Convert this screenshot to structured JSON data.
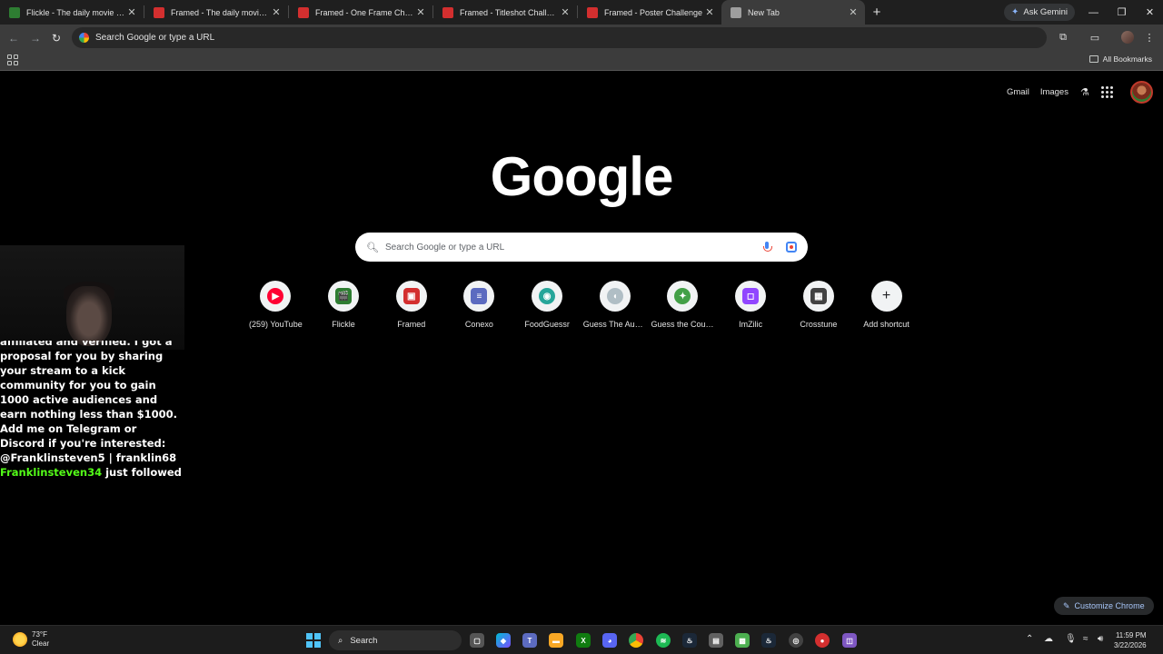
{
  "tabs": [
    {
      "title": "Flickle - The daily movie guess",
      "favicon_color": "#2e7d32",
      "active": false
    },
    {
      "title": "Framed - The daily movie guess",
      "favicon_color": "#d32f2f",
      "active": false
    },
    {
      "title": "Framed - One Frame Challenge",
      "favicon_color": "#d32f2f",
      "active": false
    },
    {
      "title": "Framed - Titleshot Challenge",
      "favicon_color": "#d32f2f",
      "active": false
    },
    {
      "title": "Framed - Poster Challenge",
      "favicon_color": "#d32f2f",
      "active": false
    },
    {
      "title": "New Tab",
      "favicon_color": "#9e9e9e",
      "active": true
    }
  ],
  "tabstrip": {
    "new_tab_icon": "+",
    "gemini_label": "Ask Gemini"
  },
  "toolbar": {
    "omnibox_text": "Search Google or type a URL"
  },
  "bookmarks": {
    "all_bookmarks_label": "All Bookmarks"
  },
  "google_links": {
    "gmail": "Gmail",
    "images": "Images"
  },
  "logo": "Google",
  "search": {
    "placeholder": "Search Google or type a URL"
  },
  "shortcuts": [
    {
      "label": "(259) YouTube",
      "icon": "youtube-icon",
      "color": "#ff0033",
      "glyph": "▶"
    },
    {
      "label": "Flickle",
      "icon": "flickle-icon",
      "color": "#2e7d32",
      "glyph": "🎬"
    },
    {
      "label": "Framed",
      "icon": "framed-icon",
      "color": "#d32f2f",
      "glyph": "▣"
    },
    {
      "label": "Conexo",
      "icon": "conexo-icon",
      "color": "#5c6bc0",
      "glyph": "≡"
    },
    {
      "label": "FoodGuessr",
      "icon": "foodguessr-icon",
      "color": "#26a69a",
      "glyph": "◉"
    },
    {
      "label": "Guess The Audi...",
      "icon": "guess-audio-icon",
      "color": "#b0bec5",
      "glyph": "◖"
    },
    {
      "label": "Guess the Coun...",
      "icon": "guess-country-icon",
      "color": "#43a047",
      "glyph": "✦"
    },
    {
      "label": "ImZilic",
      "icon": "twitch-icon",
      "color": "#9146ff",
      "glyph": "◻"
    },
    {
      "label": "Crosstune",
      "icon": "crosstune-icon",
      "color": "#424242",
      "glyph": "▦"
    },
    {
      "label": "Add shortcut",
      "icon": "plus-icon",
      "color": "#f1f3f4",
      "glyph": "+"
    }
  ],
  "chat": {
    "cut_line": "affiliated and verified. I got a",
    "message": "proposal for you by sharing your stream to a kick community for you to gain 1000 active audiences and earn nothing less than $1000. Add me on Telegram or Discord if you're interested: @Franklinsteven5 | franklin68",
    "follower_name": "Franklinsteven34",
    "follower_suffix": " just followed"
  },
  "customize": {
    "label": "Customize Chrome"
  },
  "taskbar": {
    "weather_temp": "73°F",
    "weather_cond": "Clear",
    "search_label": "Search",
    "time": "11:59 PM",
    "date": "3/22/2026"
  }
}
